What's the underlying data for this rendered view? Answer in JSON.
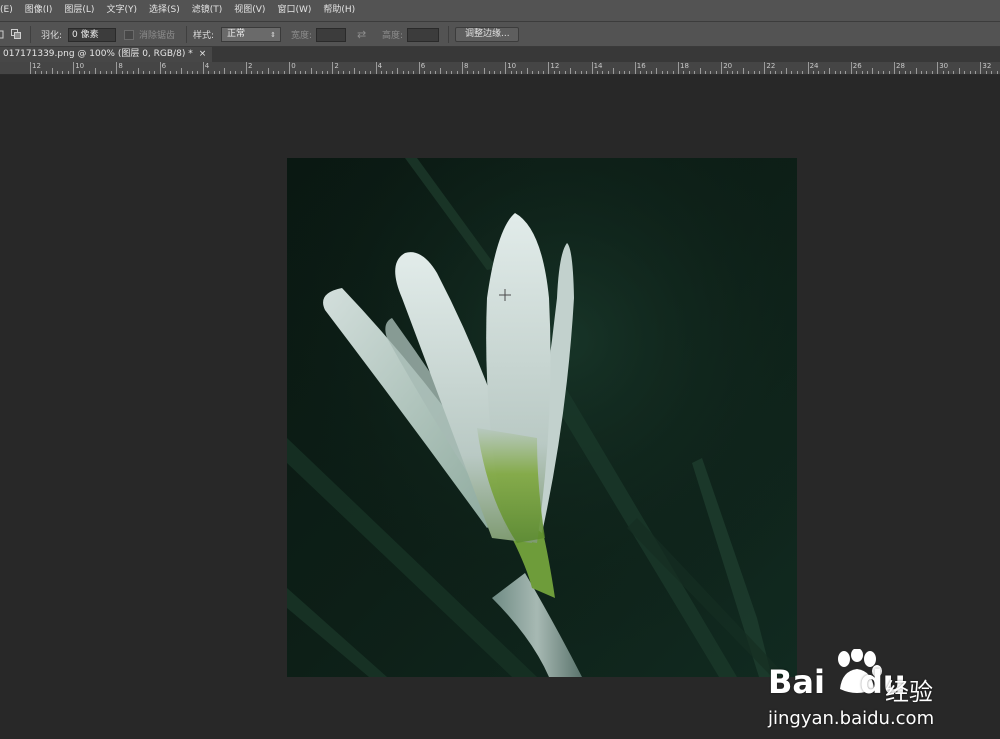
{
  "menu": {
    "items": [
      "(E)",
      "图像(I)",
      "图层(L)",
      "文字(Y)",
      "选择(S)",
      "滤镜(T)",
      "视图(V)",
      "窗口(W)",
      "帮助(H)"
    ]
  },
  "options": {
    "feather_label": "羽化:",
    "feather_value": "0 像素",
    "antialias_label": "消除锯齿",
    "style_label": "样式:",
    "style_value": "正常",
    "width_label": "宽度:",
    "height_label": "高度:",
    "refine_edge_button": "调整边缘..."
  },
  "document": {
    "tab_title": "017171339.png @ 100% (图层 0, RGB/8) *",
    "close_glyph": "×"
  },
  "ruler": {
    "labels": [
      "12",
      "10",
      "8",
      "6",
      "4",
      "2",
      "0",
      "2",
      "4",
      "6",
      "8",
      "10",
      "12",
      "14",
      "16",
      "18",
      "20",
      "22",
      "24",
      "26",
      "28",
      "30",
      "32"
    ]
  },
  "watermark": {
    "logo_text": "Bai",
    "logo_suffix": "du",
    "product_text": "经验",
    "url": "jingyan.baidu.com"
  },
  "colors": {
    "menubar_bg": "#535353",
    "workspace_bg": "#282828",
    "photo_bg": "#0f1f18"
  }
}
